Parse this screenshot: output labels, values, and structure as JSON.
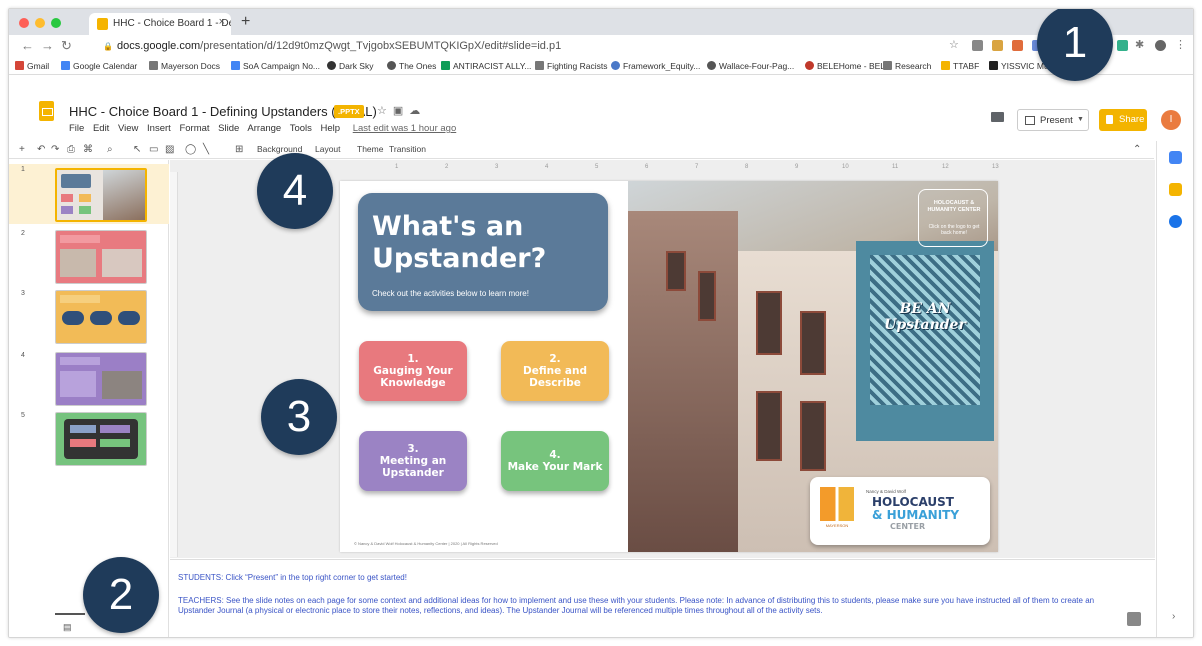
{
  "browser": {
    "tab_title": "HHC - Choice Board 1 - Defini",
    "url_host": "docs.google.com",
    "url_path": "/presentation/d/12d9t0mzQwgt_TvjgobxSEBUMTQKIGpX/edit#slide=id.p1",
    "bookmarks": [
      "Gmail",
      "Google Calendar",
      "Mayerson Docs",
      "SoA Campaign No...",
      "Dark Sky",
      "The Ones",
      "ANTIRACIST ALLY...",
      "Fighting Racists",
      "Framework_Equity...",
      "Wallace-Four-Pag...",
      "BELEHome - BELE",
      "Research",
      "TTABF",
      "YISSVIC Mu"
    ],
    "icons": [
      "back-arrow-icon",
      "forward-arrow-icon",
      "reload-icon",
      "lock-icon",
      "star-icon"
    ]
  },
  "docs": {
    "title": "HHC - Choice Board 1 - Defining Upstanders (FINAL)",
    "badge": ".PPTX",
    "menu": [
      "File",
      "Edit",
      "View",
      "Insert",
      "Format",
      "Slide",
      "Arrange",
      "Tools",
      "Help"
    ],
    "last_edit": "Last edit was 1 hour ago",
    "present_label": "Present",
    "share_label": "Share",
    "avatar_initial": "I",
    "toolbar": {
      "background": "Background",
      "layout": "Layout",
      "theme": "Theme",
      "transition": "Transition"
    },
    "accent": "#f4b400"
  },
  "filmstrip": {
    "slides": [
      {
        "num": "1",
        "color": "#e9e4df",
        "label": "What's an Upstander?"
      },
      {
        "num": "2",
        "color": "#e87a80",
        "label": "Gauging Your Knowledge"
      },
      {
        "num": "3",
        "color": "#f2bb57",
        "label": "Define and Describe"
      },
      {
        "num": "4",
        "color": "#9b7fc6",
        "label": "Meeting an Upstander"
      },
      {
        "num": "5",
        "color": "#76c37e",
        "label": "Make Your Mark"
      }
    ]
  },
  "ruler": [
    "1",
    "2",
    "3",
    "4",
    "5",
    "6",
    "7",
    "8",
    "9",
    "10",
    "11",
    "12",
    "13"
  ],
  "slide": {
    "title": "What's an Upstander?",
    "subtitle": "Check out the activities below to learn more!",
    "activities": [
      {
        "label": "1.\nGauging Your\nKnowledge",
        "color": "#e8797e"
      },
      {
        "label": "2.\nDefine and\nDescribe",
        "color": "#f2ba57"
      },
      {
        "label": "3.\nMeeting an\nUpstander",
        "color": "#9b83c4"
      },
      {
        "label": "4.\nMake Your Mark",
        "color": "#77c47d"
      }
    ],
    "footer": "© Nancy & David Wolf Holocaust & Humanity Center | 2020 | All Rights Reserved",
    "mural_text": "BE AN Upstander",
    "hhc_box_title": "HOLOCAUST & HUMANITY CENTER",
    "hhc_box_sub": "Click on the logo to get back home!",
    "logo": {
      "mayerson": "MAYERSON",
      "pre": "Nancy & David Wolf",
      "line1": "HOLOCAUST",
      "line2": "& HUMANITY",
      "line3": "CENTER"
    }
  },
  "notes": {
    "students": "STUDENTS: Click “Present” in the top right corner to get started!",
    "teachers": "TEACHERS: See the slide notes on each page for some context and additional ideas for how to implement and use these with your students. Please note: In advance of distributing this to students, please make sure you have instructed all of them to create an Upstander Journal (a physical or electronic place to store their notes, reflections, and ideas). The Upstander Journal will be referenced multiple times throughout all of the activity sets."
  },
  "callouts": [
    "1",
    "2",
    "3",
    "4"
  ]
}
